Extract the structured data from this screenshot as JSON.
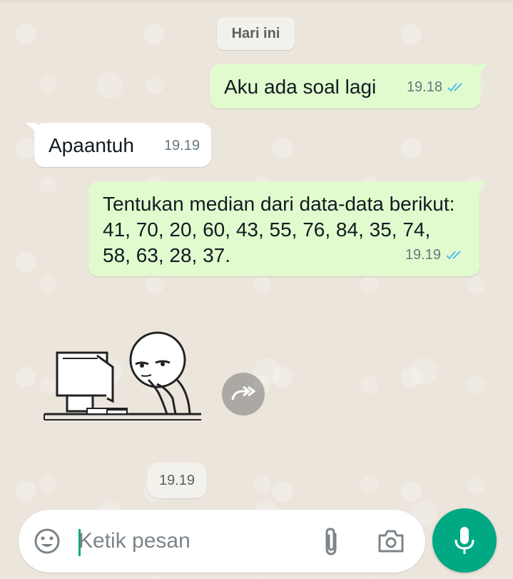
{
  "chat": {
    "date_label": "Hari ini",
    "messages": [
      {
        "direction": "outgoing",
        "text": "Aku ada soal lagi",
        "time": "19.18",
        "status": "read"
      },
      {
        "direction": "incoming",
        "text": "Apaantuh",
        "time": "19.19"
      },
      {
        "direction": "outgoing",
        "text": "Tentukan median dari data-data berikut: 41, 70, 20, 60, 43, 55, 76, 84, 35, 74, 58, 63, 28, 37.",
        "time": "19.19",
        "status": "read"
      },
      {
        "direction": "incoming",
        "type": "sticker",
        "sticker_icon": "thinking-at-computer-sticker",
        "time": "19.19"
      }
    ]
  },
  "composer": {
    "placeholder": "Ketik pesan",
    "value": "",
    "icons": {
      "emoji": "smiley-icon",
      "attach": "paperclip-icon",
      "camera": "camera-icon",
      "mic": "microphone-icon",
      "forward": "forward-arrow-icon"
    }
  },
  "colors": {
    "outgoing_bubble": "#e2fbce",
    "incoming_bubble": "#ffffff",
    "accent": "#00a884",
    "read_ticks": "#53bdeb",
    "wallpaper": "#ebe5dc"
  }
}
